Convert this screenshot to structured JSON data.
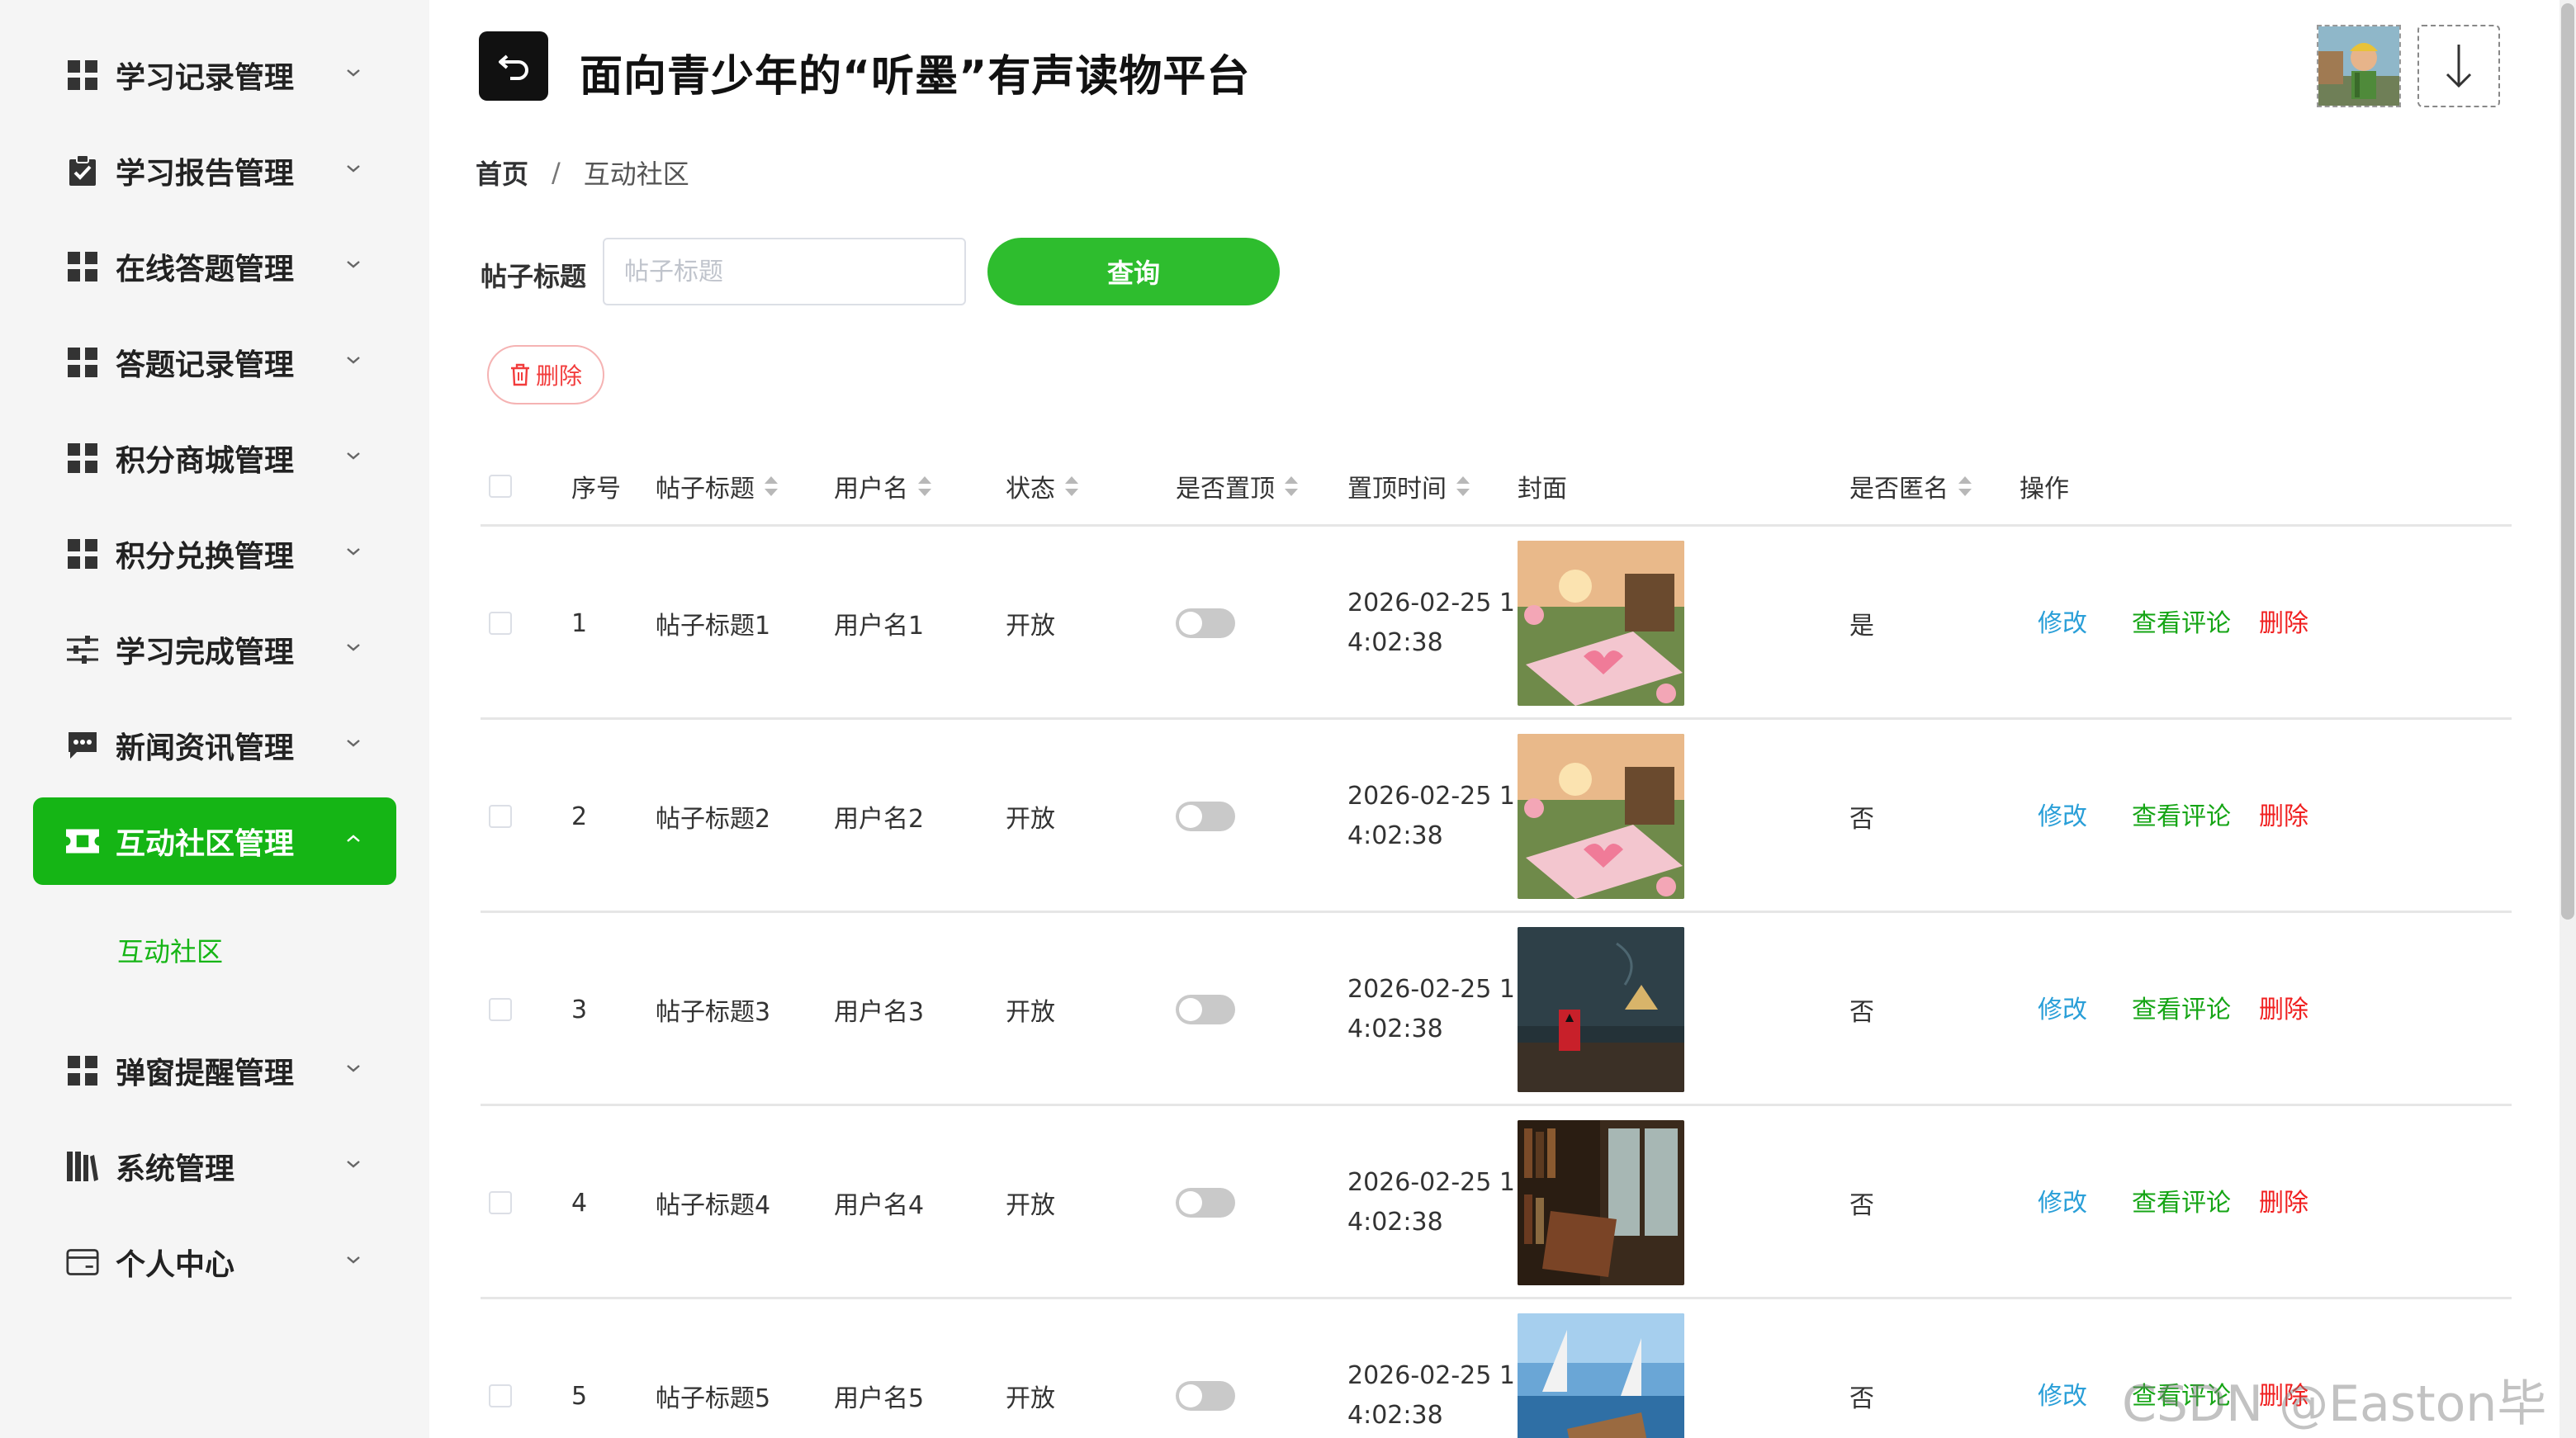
{
  "header": {
    "title": "面向青少年的“听墨”有声读物平台"
  },
  "sidebar": {
    "items": [
      {
        "label": "学习记录管理",
        "icon": "grid-icon"
      },
      {
        "label": "学习报告管理",
        "icon": "clipboard-check-icon"
      },
      {
        "label": "在线答题管理",
        "icon": "grid-icon"
      },
      {
        "label": "答题记录管理",
        "icon": "grid-icon"
      },
      {
        "label": "积分商城管理",
        "icon": "grid-icon"
      },
      {
        "label": "积分兑换管理",
        "icon": "grid-icon"
      },
      {
        "label": "学习完成管理",
        "icon": "sliders-icon"
      },
      {
        "label": "新闻资讯管理",
        "icon": "chat-icon"
      },
      {
        "label": "互动社区管理",
        "icon": "ticket-icon",
        "active": true
      },
      {
        "label": "弹窗提醒管理",
        "icon": "grid-icon"
      },
      {
        "label": "系统管理",
        "icon": "books-icon"
      },
      {
        "label": "个人中心",
        "icon": "wallet-icon"
      }
    ],
    "sub_item": "互动社区"
  },
  "breadcrumb": {
    "home": "首页",
    "separator": "/",
    "current": "互动社区"
  },
  "search": {
    "label": "帖子标题",
    "placeholder": "帖子标题",
    "query_button": "查询"
  },
  "toolbar": {
    "delete_label": "删除"
  },
  "table": {
    "columns": [
      "序号",
      "帖子标题",
      "用户名",
      "状态",
      "是否置顶",
      "置顶时间",
      "封面",
      "是否匿名",
      "操作"
    ],
    "rows": [
      {
        "index": "1",
        "title": "帖子标题1",
        "username": "用户名1",
        "status": "开放",
        "time_line1": "2026-02-25 1",
        "time_line2": "4:02:38",
        "cover": "book-heart-garden",
        "anonymous": "是"
      },
      {
        "index": "2",
        "title": "帖子标题2",
        "username": "用户名2",
        "status": "开放",
        "time_line1": "2026-02-25 1",
        "time_line2": "4:02:38",
        "cover": "book-heart-garden",
        "anonymous": "否"
      },
      {
        "index": "3",
        "title": "帖子标题3",
        "username": "用户名3",
        "status": "开放",
        "time_line1": "2026-02-25 1",
        "time_line2": "4:02:38",
        "cover": "dark-room-lamp",
        "anonymous": "否"
      },
      {
        "index": "4",
        "title": "帖子标题4",
        "username": "用户名4",
        "status": "开放",
        "time_line1": "2026-02-25 1",
        "time_line2": "4:02:38",
        "cover": "library-window",
        "anonymous": "否"
      },
      {
        "index": "5",
        "title": "帖子标题5",
        "username": "用户名5",
        "status": "开放",
        "time_line1": "2026-02-25 1",
        "time_line2": "4:02:38",
        "cover": "sailboats-sea",
        "anonymous": "否"
      }
    ],
    "actions": {
      "edit": "修改",
      "comments": "查看评论",
      "delete": "删除"
    }
  },
  "watermark": "CSDN @Easton毕设",
  "colors": {
    "accent": "#15b515",
    "query_button": "#2ebd2e",
    "edit_link": "#2a9fd8",
    "comment_link": "#15a515",
    "delete_link": "#f02020"
  }
}
